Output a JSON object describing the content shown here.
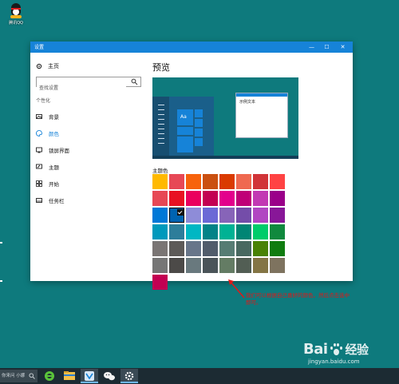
{
  "desktop": {
    "qq_label": "腾讯QQ"
  },
  "window": {
    "title": "设置",
    "controls": {
      "minimize": "—",
      "maximize": "☐",
      "close": "✕"
    }
  },
  "nav": {
    "home": "主页",
    "search_placeholder": "查找设置",
    "section": "个性化",
    "items": [
      {
        "label": "背景",
        "icon": "picture-icon"
      },
      {
        "label": "颜色",
        "icon": "palette-icon"
      },
      {
        "label": "锁屏界面",
        "icon": "lock-screen-icon"
      },
      {
        "label": "主题",
        "icon": "brush-icon"
      },
      {
        "label": "开始",
        "icon": "start-icon"
      },
      {
        "label": "任务栏",
        "icon": "taskbar-icon"
      }
    ],
    "active_item": "颜色"
  },
  "content": {
    "preview_heading": "预览",
    "preview_tile_text": "Aa",
    "preview_window_text": "示例文本",
    "theme_color_heading": "主题色",
    "selected_color": "#0063b1",
    "swatch_rows": [
      [
        "#ffb900",
        "#e74856",
        "#f7630c",
        "#ca5010",
        "#da3b01",
        "#ef6950",
        "#d13438",
        "#ff4343"
      ],
      [
        "#e74856",
        "#e81123",
        "#ea005e",
        "#c30052",
        "#e3008c",
        "#bf0077",
        "#c239b3",
        "#9a0089"
      ],
      [
        "#0078d7",
        "#0063b1",
        "#8e8cd8",
        "#6b69d6",
        "#8764b8",
        "#744da9",
        "#b146c2",
        "#881798"
      ],
      [
        "#0099bc",
        "#2d7d9a",
        "#00b7c3",
        "#038387",
        "#00b294",
        "#018574",
        "#00cc6a",
        "#10893e"
      ],
      [
        "#7a7574",
        "#5d5a58",
        "#68768a",
        "#515c6b",
        "#567c73",
        "#486860",
        "#498205",
        "#107c10"
      ],
      [
        "#767676",
        "#4c4a48",
        "#69797e",
        "#4a5459",
        "#647c64",
        "#525e54",
        "#847545",
        "#7e735f"
      ],
      [
        "#c30052"
      ]
    ]
  },
  "annotation": {
    "text": "我们可以根据自己喜好的颜色，然后点击选中即可。",
    "color": "#e01818"
  },
  "watermark": {
    "brand_left": "Bai",
    "brand_right": "经验",
    "url": "jingyan.baidu.com"
  },
  "taskbar": {
    "search_text": "你来问 小娜",
    "icons": [
      "search-icon",
      "ie-icon",
      "file-explorer-icon",
      "browser-icon",
      "wechat-icon",
      "settings-icon"
    ]
  }
}
